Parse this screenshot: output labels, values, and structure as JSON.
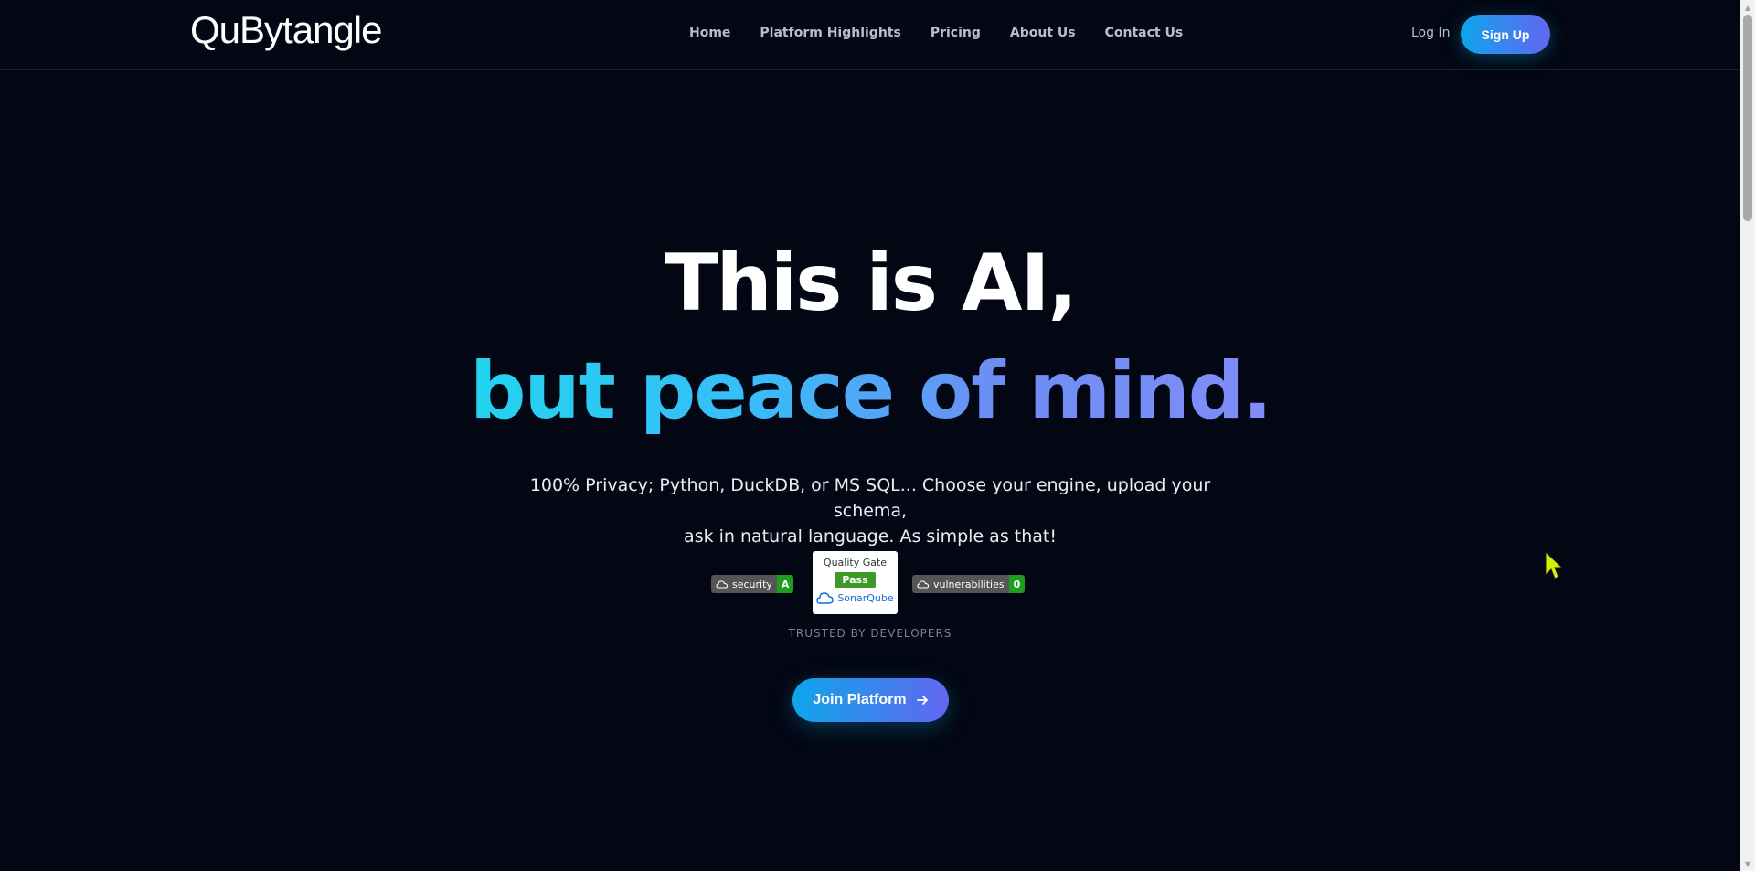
{
  "header": {
    "logo": "QuBytangle",
    "nav": [
      "Home",
      "Platform Highlights",
      "Pricing",
      "About Us",
      "Contact Us"
    ],
    "login_label": "Log In",
    "signup_label": "Sign Up"
  },
  "hero": {
    "title_line1": "This is AI,",
    "title_line2": "but peace of mind.",
    "subtitle_line1": "100% Privacy; Python, DuckDB, or MS SQL... Choose your engine, upload your schema,",
    "subtitle_line2": "ask in natural language. As simple as that!"
  },
  "badges": {
    "security": {
      "label": "security",
      "value": "A"
    },
    "quality_gate": {
      "title": "Quality Gate",
      "status": "Pass",
      "brand": "SonarQube"
    },
    "vulnerabilities": {
      "label": "vulnerabilities",
      "value": "0"
    },
    "trusted_text": "TRUSTED BY DEVELOPERS"
  },
  "cta": {
    "join_label": "Join Platform"
  },
  "colors": {
    "background": "#030713",
    "accent_start": "#0ea5e9",
    "accent_end": "#6366f1",
    "badge_green": "#1f9d1f",
    "cursor": "#d4f000"
  },
  "icons": [
    "arrow-right-icon",
    "sonar-cloud-icon",
    "cursor-icon"
  ]
}
